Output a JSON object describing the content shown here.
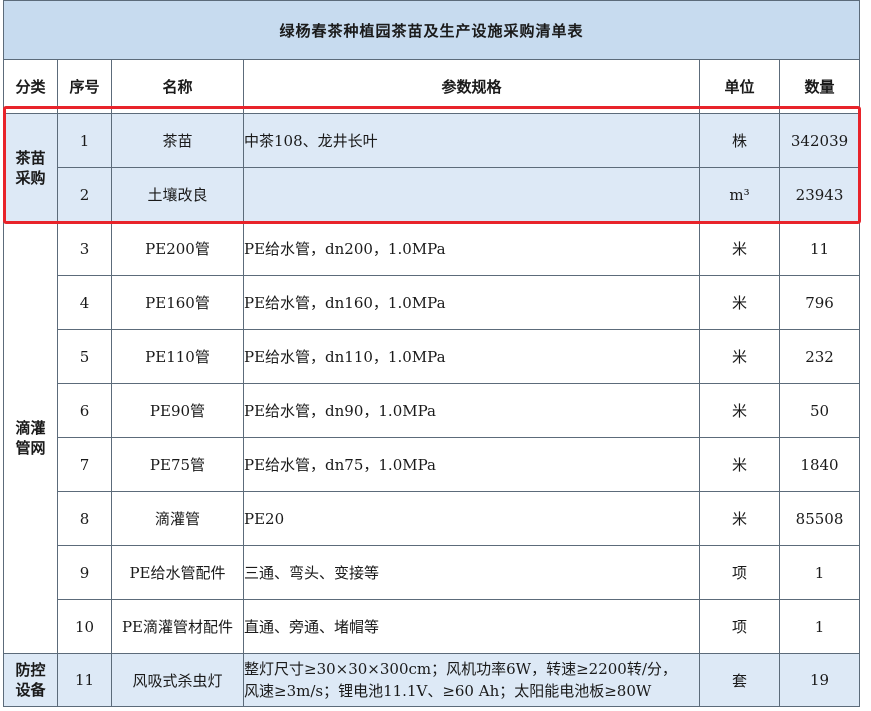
{
  "title": "绿杨春茶种植园茶苗及生产设施采购清单表",
  "headers": {
    "category": "分类",
    "seq": "序号",
    "name": "名称",
    "spec": "参数规格",
    "unit": "单位",
    "qty": "数量"
  },
  "categories": {
    "seedling": [
      "茶苗",
      "采购"
    ],
    "drip": [
      "滴灌",
      "管网"
    ],
    "pest": [
      "防控",
      "设备"
    ]
  },
  "rows": [
    {
      "seq": "1",
      "name": "茶苗",
      "spec": "中茶108、龙井长叶",
      "unit": "株",
      "qty": "342039"
    },
    {
      "seq": "2",
      "name": "土壤改良",
      "spec": "",
      "unit": "m³",
      "qty": "23943"
    },
    {
      "seq": "3",
      "name": "PE200管",
      "spec": "PE给水管，dn200，1.0MPa",
      "unit": "米",
      "qty": "11"
    },
    {
      "seq": "4",
      "name": "PE160管",
      "spec": "PE给水管，dn160，1.0MPa",
      "unit": "米",
      "qty": "796"
    },
    {
      "seq": "5",
      "name": "PE110管",
      "spec": "PE给水管，dn110，1.0MPa",
      "unit": "米",
      "qty": "232"
    },
    {
      "seq": "6",
      "name": "PE90管",
      "spec": "PE给水管，dn90，1.0MPa",
      "unit": "米",
      "qty": "50"
    },
    {
      "seq": "7",
      "name": "PE75管",
      "spec": "PE给水管，dn75，1.0MPa",
      "unit": "米",
      "qty": "1840"
    },
    {
      "seq": "8",
      "name": "滴灌管",
      "spec": "PE20",
      "unit": "米",
      "qty": "85508"
    },
    {
      "seq": "9",
      "name": "PE给水管配件",
      "spec": "三通、弯头、变接等",
      "unit": "项",
      "qty": "1"
    },
    {
      "seq": "10",
      "name": "PE滴灌管材配件",
      "spec": "直通、旁通、堵帽等",
      "unit": "项",
      "qty": "1"
    },
    {
      "seq": "11",
      "name": "风吸式杀虫灯",
      "spec_lines": [
        "整灯尺寸≥30×30×300cm；风机功率6W，转速≥2200转/分，",
        "风速≥3m/s；锂电池11.1V、≥60 Ah；太阳能电池板≥80W"
      ],
      "unit": "套",
      "qty": "19"
    }
  ]
}
